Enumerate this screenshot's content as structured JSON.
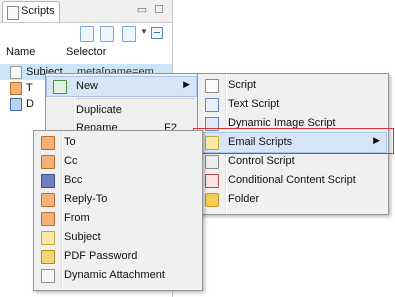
{
  "view": {
    "tab_label": "Scripts",
    "window_buttons": [
      "minimize-icon",
      "maximize-icon"
    ],
    "toolbar_icons": [
      "new-script-icon",
      "new-folder-icon",
      "new-wizard-icon",
      "collapse-all-icon"
    ],
    "columns": {
      "name": "Name",
      "selector": "Selector"
    },
    "rows": [
      {
        "name": "Subject",
        "selector": "meta[name=em",
        "icon": "subject-icon",
        "selected": true
      },
      {
        "name": "T",
        "selector": "",
        "icon": "to-icon"
      },
      {
        "name": "D",
        "selector": "",
        "icon": "dynamic-icon"
      }
    ]
  },
  "context_menu": {
    "items": [
      {
        "label": "New",
        "icon": "new-icon",
        "submenu": true,
        "highlighted": true
      },
      {
        "label": "Duplicate"
      },
      {
        "label": "Rename",
        "shortcut": "F2"
      }
    ]
  },
  "new_submenu": {
    "items": [
      {
        "label": "Script",
        "icon": "script-icon"
      },
      {
        "label": "Text Script",
        "icon": "text-script-icon"
      },
      {
        "label": "Dynamic Image Script",
        "icon": "dynamic-image-icon"
      },
      {
        "label": "Email Scripts",
        "icon": "email-scripts-icon",
        "submenu": true,
        "highlighted": true
      },
      {
        "label": "Control Script",
        "icon": "control-script-icon"
      },
      {
        "label": "Conditional Content Script",
        "icon": "conditional-content-icon"
      },
      {
        "label": "Folder",
        "icon": "folder-icon"
      }
    ]
  },
  "email_submenu": {
    "items": [
      {
        "label": "To",
        "icon": "person-icon"
      },
      {
        "label": "Cc",
        "icon": "person-icon"
      },
      {
        "label": "Bcc",
        "icon": "person-dark-icon"
      },
      {
        "label": "Reply-To",
        "icon": "person-icon"
      },
      {
        "label": "From",
        "icon": "person-icon"
      },
      {
        "label": "Subject",
        "icon": "subject-icon"
      },
      {
        "label": "PDF Password",
        "icon": "pdf-password-icon"
      },
      {
        "label": "Dynamic Attachment",
        "icon": "attachment-icon"
      }
    ]
  },
  "colors": {
    "callout": "#e03030",
    "selection": "#cde4f7",
    "menu_bg": "#f0f0f0"
  }
}
